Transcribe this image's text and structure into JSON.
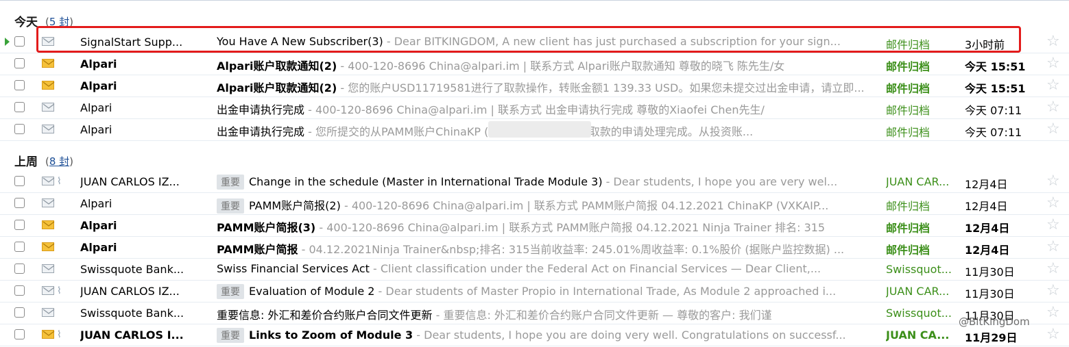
{
  "groups": [
    {
      "title": "今天",
      "count": "5 封",
      "rows": [
        {
          "sender": "SignalStart Supp...",
          "tag": "",
          "subject": "You Have A New Subscriber(3)",
          "snippet": "Dear BITKINGDOM, A new client has just purchased a subscription for your sign...",
          "folder": "邮件归档",
          "date": "3小时前",
          "unread": false,
          "attach": false,
          "marker": true
        },
        {
          "sender": "Alpari",
          "tag": "",
          "subject": "Alpari账户取款通知(2)",
          "snippet": "400-120-8696  China@alpari.im | 联系方式   Alpari账户取款通知 尊敬的晓飞 陈先生/女",
          "folder": "邮件归档",
          "date": "今天 15:51",
          "unread": true,
          "attach": false,
          "marker": false
        },
        {
          "sender": "Alpari",
          "tag": "",
          "subject": "Alpari账户取款通知(2)",
          "snippet": "您的账户USD11719581进行了取款操作，转账金额1 139.33 USD。如果您未提交过出金申请，请立即...",
          "folder": "邮件归档",
          "date": "今天 15:51",
          "unread": true,
          "attach": false,
          "marker": false
        },
        {
          "sender": "Alpari",
          "tag": "",
          "subject": "出金申请执行完成",
          "snippet": "400-120-8696  China@alpari.im | 联系方式   出金申请执行完成 尊敬的Xiaofei Chen先生/",
          "folder": "邮件归档",
          "date": "今天 07:11",
          "unread": false,
          "attach": false,
          "marker": false
        },
        {
          "sender": "Alpari",
          "tag": "",
          "subject": "出金申请执行完成",
          "snippet": "您所提交的从PAMM账户ChinaKP                          (投资账户3751339) 取款的申请处理完成。从投资账...",
          "folder": "邮件归档",
          "date": "今天 07:11",
          "unread": false,
          "attach": false,
          "marker": false
        }
      ]
    },
    {
      "title": "上周",
      "count": "8 封",
      "rows": [
        {
          "sender": "JUAN CARLOS IZ...",
          "tag": "重要",
          "subject": "Change in the schedule (Master in International Trade Module 3)",
          "snippet": "Dear students,   I hope you are very wel...",
          "folder": "JUAN CAR...",
          "date": "12月4日",
          "unread": false,
          "attach": true,
          "marker": false
        },
        {
          "sender": "Alpari",
          "tag": "重要",
          "subject": "PAMM账户简报(2)",
          "snippet": "400-120-8696  China@alpari.im | 联系方式   PAMM账户简报 04.12.2021 ChinaKP  (VXKAIP...",
          "folder": "邮件归档",
          "date": "12月4日",
          "unread": false,
          "attach": false,
          "marker": false
        },
        {
          "sender": "Alpari",
          "tag": "",
          "subject": "PAMM账户简报(3)",
          "snippet": "400-120-8696  China@alpari.im | 联系方式   PAMM账户简报 04.12.2021 Ninja Trainer 排名: 315",
          "folder": "邮件归档",
          "date": "12月4日",
          "unread": true,
          "attach": false,
          "marker": false
        },
        {
          "sender": "Alpari",
          "tag": "",
          "subject": "PAMM账户简报",
          "snippet": "04.12.2021Ninja Trainer&nbsp;排名: 315当前收益率: 245.01%周收益率: 0.1%股价 (据账户监控数据) ...",
          "folder": "邮件归档",
          "date": "12月4日",
          "unread": true,
          "attach": false,
          "marker": false
        },
        {
          "sender": "Swissquote Bank...",
          "tag": "",
          "subject": "Swiss Financial Services Act",
          "snippet": "Client classification under the Federal Act on Financial Services  —     Dear Client,...",
          "folder": "Swissquot...",
          "date": "11月30日",
          "unread": false,
          "attach": false,
          "marker": false
        },
        {
          "sender": "JUAN CARLOS IZ...",
          "tag": "重要",
          "subject": "Evaluation of Module 2",
          "snippet": "Dear students of Master Propio in International Trade,  As Module 2 approached i...",
          "folder": "JUAN CAR...",
          "date": "11月30日",
          "unread": false,
          "attach": true,
          "marker": false
        },
        {
          "sender": "Swissquote Bank...",
          "tag": "",
          "subject": "重要信息: 外汇和差价合约账户合同文件更新",
          "snippet": "重要信息: 外汇和差价合约账户合同文件更新  —     尊敬的客户:   我们谨",
          "folder": "Swissquot...",
          "date": "11月30日",
          "unread": false,
          "attach": false,
          "marker": false
        },
        {
          "sender": "JUAN CARLOS I...",
          "tag": "重要",
          "subject": "Links to Zoom of Module 3",
          "snippet": "Dear students,   I hope you are doing very well. Congratulations on successf...",
          "folder": "JUAN CA...",
          "date": "11月29日",
          "unread": true,
          "attach": true,
          "marker": false
        }
      ]
    }
  ],
  "watermark": "@BitKingDom",
  "colors": {
    "folder": "#3c8f1a",
    "highlight": "#e31b1b",
    "link": "#1c4e96"
  }
}
